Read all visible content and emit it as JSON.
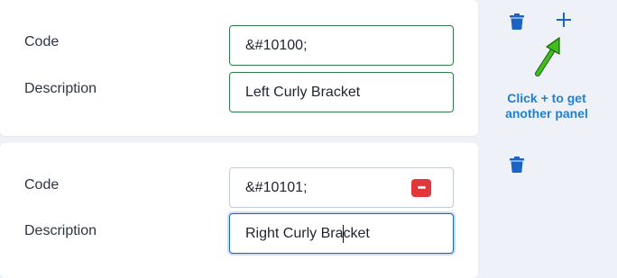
{
  "panels": [
    {
      "code_label": "Code",
      "code_value": "&#10100;",
      "description_label": "Description",
      "description_value": "Left Curly Bracket"
    },
    {
      "code_label": "Code",
      "code_value": "&#10101;",
      "description_label": "Description",
      "description_value_before_caret": "Right Curly Bra",
      "description_value_after_caret": "cket",
      "password_manager_icon": "•••"
    }
  ],
  "annotation": {
    "hint_line1": "Click + to get",
    "hint_line2": "another panel"
  },
  "icons": {
    "delete": "trash-icon",
    "add": "plus-icon",
    "arrow": "green-arrow-icon"
  },
  "colors": {
    "accent": "#1b64c4",
    "valid_border": "#2f7d46",
    "hint_text": "#1f80d6",
    "arrow": "#3fbf1f",
    "password_icon": "#e0383a"
  }
}
